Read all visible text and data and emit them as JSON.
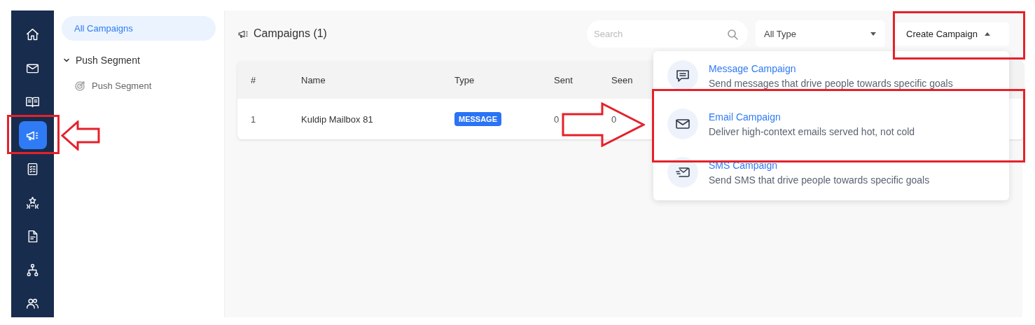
{
  "nav": {
    "items": [
      {
        "kind": "home",
        "selected": false,
        "highlighted": false
      },
      {
        "kind": "mail",
        "selected": false,
        "highlighted": false
      },
      {
        "kind": "book",
        "selected": false,
        "highlighted": false
      },
      {
        "kind": "megaphone",
        "selected": true,
        "highlighted": true
      },
      {
        "kind": "checklist",
        "selected": false,
        "highlighted": false
      },
      {
        "kind": "stars",
        "selected": false,
        "highlighted": false
      },
      {
        "kind": "document",
        "selected": false,
        "highlighted": false
      },
      {
        "kind": "hierarchy",
        "selected": false,
        "highlighted": false
      },
      {
        "kind": "people",
        "selected": false,
        "highlighted": false
      }
    ]
  },
  "sidebar": {
    "items": [
      {
        "label": "All Campaigns",
        "selected": true
      },
      {
        "label": "Push Segment",
        "expanded": true,
        "children": [
          {
            "label": "Push Segment",
            "selected": false
          }
        ]
      }
    ]
  },
  "header": {
    "title": "Campaigns (1)",
    "search": {
      "placeholder": "Search"
    },
    "filter": {
      "value": "All Type"
    },
    "create_button": {
      "label": "Create Campaign",
      "highlighted": true
    }
  },
  "table": {
    "columns": [
      "#",
      "Name",
      "Type",
      "Sent",
      "Seen"
    ],
    "rows": [
      {
        "cells": [
          "1",
          "Kuldip Mailbox 81",
          "MESSAGE",
          "0",
          "0"
        ]
      }
    ]
  },
  "create_menu": {
    "items": [
      {
        "kind": "message",
        "title": "Message Campaign",
        "description": "Send messages that drive people towards specific goals",
        "highlighted": false
      },
      {
        "kind": "email",
        "title": "Email Campaign",
        "description": "Deliver high-context emails served hot, not cold",
        "highlighted": true
      },
      {
        "kind": "sms",
        "title": "SMS Campaign",
        "description": "Send SMS that drive people towards specific goals",
        "highlighted": false
      }
    ]
  }
}
